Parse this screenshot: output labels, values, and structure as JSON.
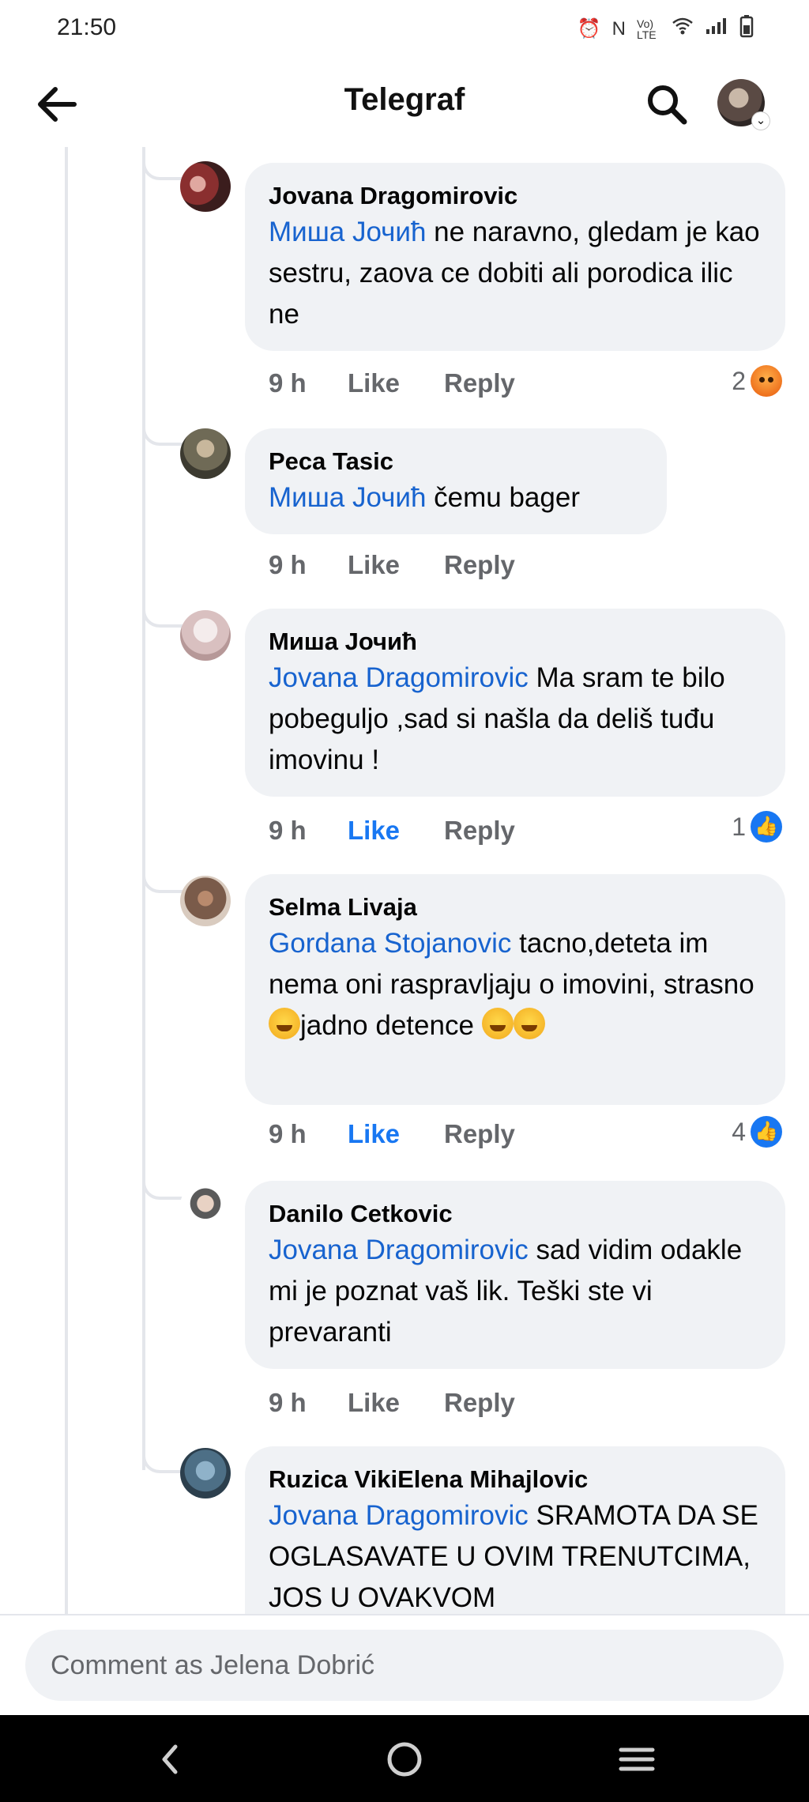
{
  "status": {
    "time": "21:50",
    "icons": [
      "alarm-icon",
      "nfc-icon",
      "volte-icon",
      "wifi-icon",
      "signal-icon",
      "battery-icon"
    ],
    "volte_label": "Vo) LTE"
  },
  "header": {
    "title": "Telegraf",
    "back_icon": "arrow-left-icon",
    "search_icon": "search-icon",
    "profile_icon": "profile-avatar"
  },
  "comments": [
    {
      "author": "Jovana Dragomirovic",
      "mention": "Миша Јочић",
      "text": " ne naravno, gledam je kao sestru, zaova ce dobiti ali porodica ilic ne",
      "time": "9 h",
      "like_label": "Like",
      "like_active": false,
      "reply_label": "Reply",
      "reaction_count": "2",
      "reaction_icon": "angry-icon"
    },
    {
      "author": "Peca Tasic",
      "mention": "Миша Јочић",
      "text": " čemu bager",
      "time": "9 h",
      "like_label": "Like",
      "like_active": false,
      "reply_label": "Reply"
    },
    {
      "author": "Миша Јочић",
      "mention": "Jovana Dragomirovic",
      "text": " Ma sram te bilo pobeguljo ,sad si našla da deliš tuđu imovinu !",
      "time": "9 h",
      "like_label": "Like",
      "like_active": true,
      "reply_label": "Reply",
      "reaction_count": "1",
      "reaction_icon": "like-icon"
    },
    {
      "author": "Selma Livaja",
      "mention": "Gordana Stojanovic",
      "text": " tacno,deteta im nema oni raspravljaju o imovini, strasno ",
      "text_after": "jadno detence",
      "time": "9 h",
      "like_label": "Like",
      "like_active": true,
      "reply_label": "Reply",
      "reaction_count": "4",
      "reaction_icon": "like-icon"
    },
    {
      "author": "Danilo Cetkovic",
      "mention": "Jovana Dragomirovic",
      "text": " sad vidim odakle mi je poznat vaš lik. Teški ste vi prevaranti",
      "time": "9 h",
      "like_label": "Like",
      "like_active": false,
      "reply_label": "Reply"
    },
    {
      "author": "Ruzica VikiElena Mihajlovic",
      "mention": "Jovana Dragomirovic",
      "text": "  SRAMOTA DA SE OGLASAVATE U OVIM TRENUTCIMA, JOS U OVAKVOM"
    }
  ],
  "composer": {
    "placeholder": "Comment as Jelena Dobrić"
  },
  "nav": {
    "back_icon": "nav-back-icon",
    "home_icon": "nav-home-icon",
    "recents_icon": "nav-recents-icon"
  }
}
